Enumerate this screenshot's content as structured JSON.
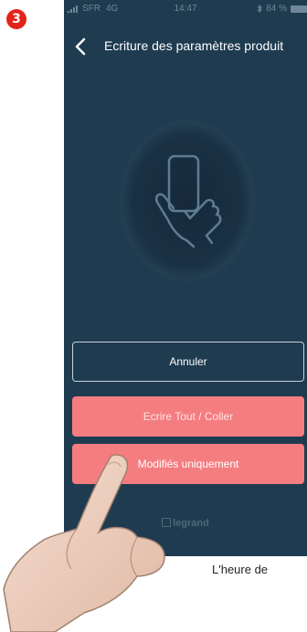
{
  "step_badge": "3",
  "status_bar": {
    "carrier": "SFR",
    "network": "4G",
    "time": "14:47",
    "battery": "84 %"
  },
  "nav": {
    "back_icon": "chevron-left-icon",
    "title": "Ecriture des paramètres produit"
  },
  "illustration": {
    "icon": "hand-holding-phone-icon"
  },
  "buttons": {
    "cancel": "Annuler",
    "write_all": "Ecrire Tout / Coller",
    "modified_only": "Modifiés uniquement"
  },
  "brand": "legrand",
  "footnote": "L'heure de",
  "colors": {
    "screen_background": "#1f3b50",
    "button_accent": "#f47d80",
    "badge": "#e2231a",
    "skin": "#efd3c3"
  }
}
